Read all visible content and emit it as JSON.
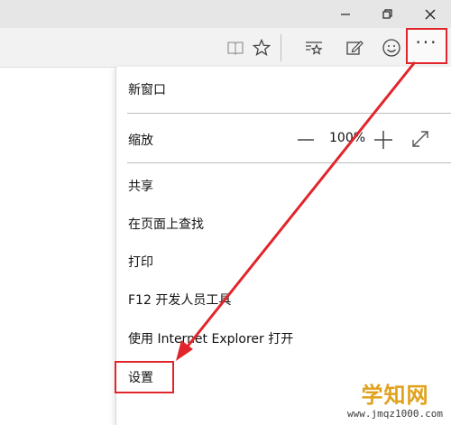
{
  "window": {
    "minimize_icon": "minimize-icon",
    "restore_icon": "restore-icon",
    "close_icon": "close-icon"
  },
  "toolbar": {
    "icons": [
      "reading-view-icon",
      "favorites-star-icon",
      "hub-icon",
      "web-note-icon",
      "feedback-smiley-icon"
    ],
    "more_label": "···"
  },
  "menu": {
    "new_window": "新窗口",
    "zoom_label": "缩放",
    "zoom_value": "100%",
    "share": "共享",
    "find_on_page": "在页面上查找",
    "print": "打印",
    "dev_tools": "F12 开发人员工具",
    "open_with_ie": "使用 Internet Explorer 打开",
    "settings": "设置"
  },
  "annotation": {
    "highlight_color": "#e1262b"
  },
  "watermark": {
    "main": "学知网",
    "sub": "www.jmqz1000.com"
  }
}
